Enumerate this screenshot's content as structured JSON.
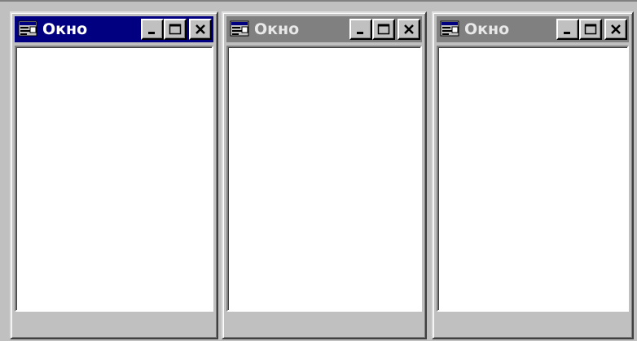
{
  "windows": [
    {
      "title": "Окно",
      "state": "active"
    },
    {
      "title": "Окно",
      "state": "inactive"
    },
    {
      "title": "Окно",
      "state": "inactive"
    }
  ],
  "colors": {
    "active_titlebar": "#000080",
    "inactive_titlebar": "#808080",
    "face": "#c0c0c0",
    "client": "#ffffff"
  },
  "icons": {
    "app": "window-app-icon",
    "minimize": "minimize-icon",
    "maximize": "maximize-icon",
    "close": "close-icon"
  }
}
